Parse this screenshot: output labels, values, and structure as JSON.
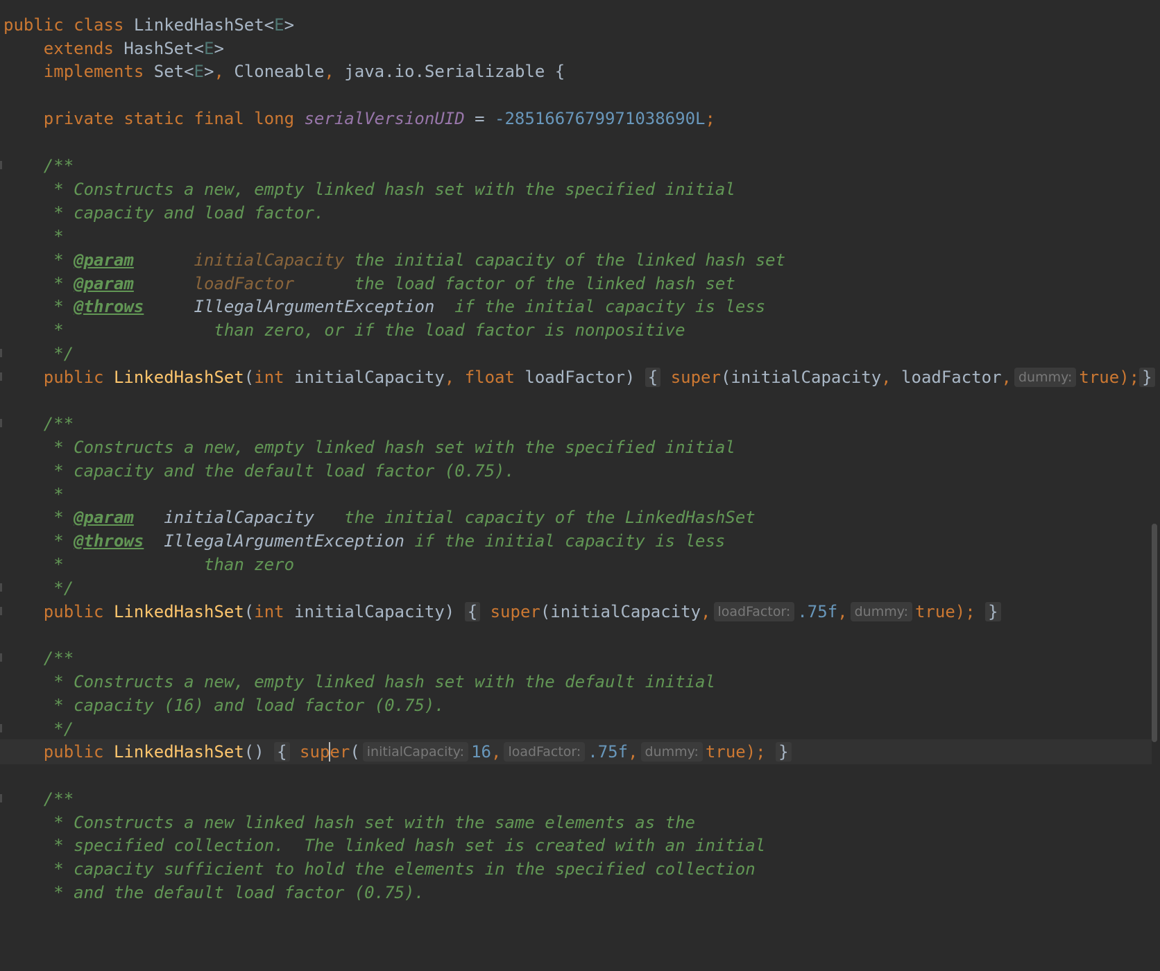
{
  "editor": {
    "l1": {
      "t1": "public class",
      "t2": " LinkedHashSet<",
      "t3": "E",
      "t4": ">"
    },
    "l2": {
      "t1": "extends",
      "t2": " HashSet<",
      "t3": "E",
      "t4": ">"
    },
    "l3": {
      "t1": "implements",
      "t2": " Set<",
      "t3": "E",
      "t4": ">",
      "t5": ",",
      "t6": " Cloneable",
      "t7": ",",
      "t8": " java.io.Serializable {"
    },
    "l5": {
      "t1": "private static final long",
      "t2": "serialVersionUID",
      "t3": " = ",
      "t4": "-2851667679971038690L",
      "t5": ";"
    },
    "c1": {
      "a": "/**",
      "b": " * Constructs a new, empty linked hash set with the specified initial",
      "c": " * capacity and load factor.",
      "d": " *",
      "e1": " * ",
      "e2": "@param",
      "e3": "      initialCapacity",
      "e4": " the initial capacity of the linked hash set",
      "f1": " * ",
      "f2": "@param",
      "f3": "      loadFactor",
      "f4": "      the load factor of the linked hash set",
      "g1": " * ",
      "g2": "@throws",
      "g3": "     IllegalArgumentException",
      "g4": "  if the initial capacity is less",
      "h": " *               than zero, or if the load factor is nonpositive",
      "i": " */"
    },
    "ctor1": {
      "kw": "public",
      "name": " LinkedHashSet",
      "p1": "(",
      "int": "int",
      "a1": " initialCapacity",
      "comma": ",",
      "float": " float",
      "a2": " loadFactor)",
      "ob": "{",
      "sup": " super",
      "args": "(initialCapacity",
      "c2": ",",
      "a3": " loadFactor",
      "c3": ",",
      "hint": "dummy:",
      "tr": "true",
      "end": ");",
      "cb": "}"
    },
    "c2": {
      "a": "/**",
      "b": " * Constructs a new, empty linked hash set with the specified initial",
      "c": " * capacity and the default load factor (0.75).",
      "d": " *",
      "e1": " * ",
      "e2": "@param",
      "e3": "   initialCapacity",
      "e4": "   the initial capacity of the LinkedHashSet",
      "f1": " * ",
      "f2": "@throws",
      "f3": "  IllegalArgumentException",
      "f4": " if the initial capacity is less",
      "g": " *              than zero",
      "h": " */"
    },
    "ctor2": {
      "kw": "public",
      "name": " LinkedHashSet",
      "p1": "(",
      "int": "int",
      "a1": " initialCapacity)",
      "ob": "{",
      "sup": " super",
      "args": "(initialCapacity",
      "c2": ",",
      "hint1": "loadFactor:",
      "v1": ".75f",
      "c3": ",",
      "hint2": "dummy:",
      "tr": "true",
      "end": ");",
      "cb": "}"
    },
    "c3": {
      "a": "/**",
      "b": " * Constructs a new, empty linked hash set with the default initial",
      "c": " * capacity (16) and load factor (0.75).",
      "d": " */"
    },
    "ctor3": {
      "kw": "public",
      "name": " LinkedHashSet",
      "p1": "()",
      "ob": "{",
      "sup1": " sup",
      "sup2": "er",
      "paren": "(",
      "hint1": "initialCapacity:",
      "v1": "16",
      "c1": ",",
      "hint2": "loadFactor:",
      "v2": ".75f",
      "c2": ",",
      "hint3": "dummy:",
      "tr": "true",
      "end": ");",
      "cb": "}"
    },
    "c4": {
      "a": "/**",
      "b": " * Constructs a new linked hash set with the same elements as the",
      "c": " * specified collection.  The linked hash set is created with an initial",
      "d": " * capacity sufficient to hold the elements in the specified collection",
      "e": " * and the default load factor (0.75)."
    }
  },
  "colors": {
    "background": "#2b2b2b",
    "keyword": "#cc7832",
    "method": "#ffc66d",
    "number": "#6897bb",
    "comment": "#629755",
    "field": "#9876aa"
  }
}
